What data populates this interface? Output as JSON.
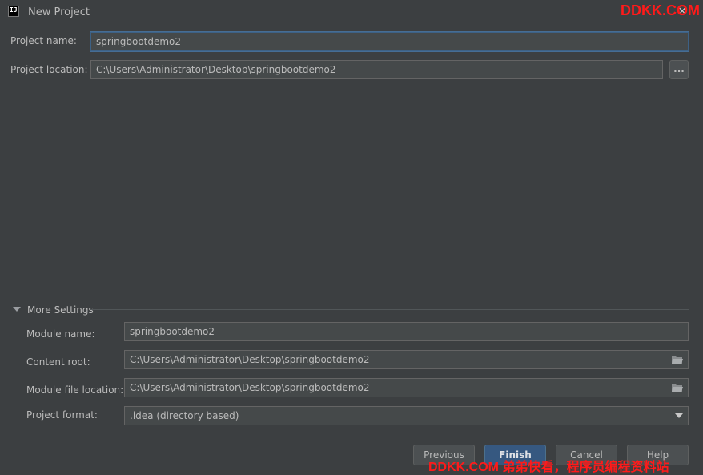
{
  "window": {
    "title": "New Project",
    "close_glyph": "×",
    "icon": "intellij-icon",
    "icon_text": "IJ"
  },
  "watermark": {
    "top": "DDKK.COM",
    "bottom": "DDKK.COM 弟弟快看，程序员编程资料站"
  },
  "form": {
    "project_name": {
      "label": "Project name:",
      "value": "springbootdemo2"
    },
    "project_location": {
      "label": "Project location:",
      "value": "C:\\Users\\Administrator\\Desktop\\springbootdemo2",
      "browse_label": "..."
    }
  },
  "more_settings": {
    "title": "More Settings",
    "expanded": true,
    "module_name": {
      "label": "Module name:",
      "value": "springbootdemo2"
    },
    "content_root": {
      "label": "Content root:",
      "value": "C:\\Users\\Administrator\\Desktop\\springbootdemo2",
      "icon": "folder-icon"
    },
    "module_file_location": {
      "label": "Module file location:",
      "value": "C:\\Users\\Administrator\\Desktop\\springbootdemo2",
      "icon": "folder-icon"
    },
    "project_format": {
      "label": "Project format:",
      "value": ".idea (directory based)"
    }
  },
  "buttons": {
    "previous": "Previous",
    "finish": "Finish",
    "cancel": "Cancel",
    "help": "Help"
  },
  "colors": {
    "background": "#3c3f41",
    "field_background": "#45494a",
    "primary_button": "#365880",
    "focus_border": "#3d6185",
    "watermark": "#ff1a1a"
  }
}
